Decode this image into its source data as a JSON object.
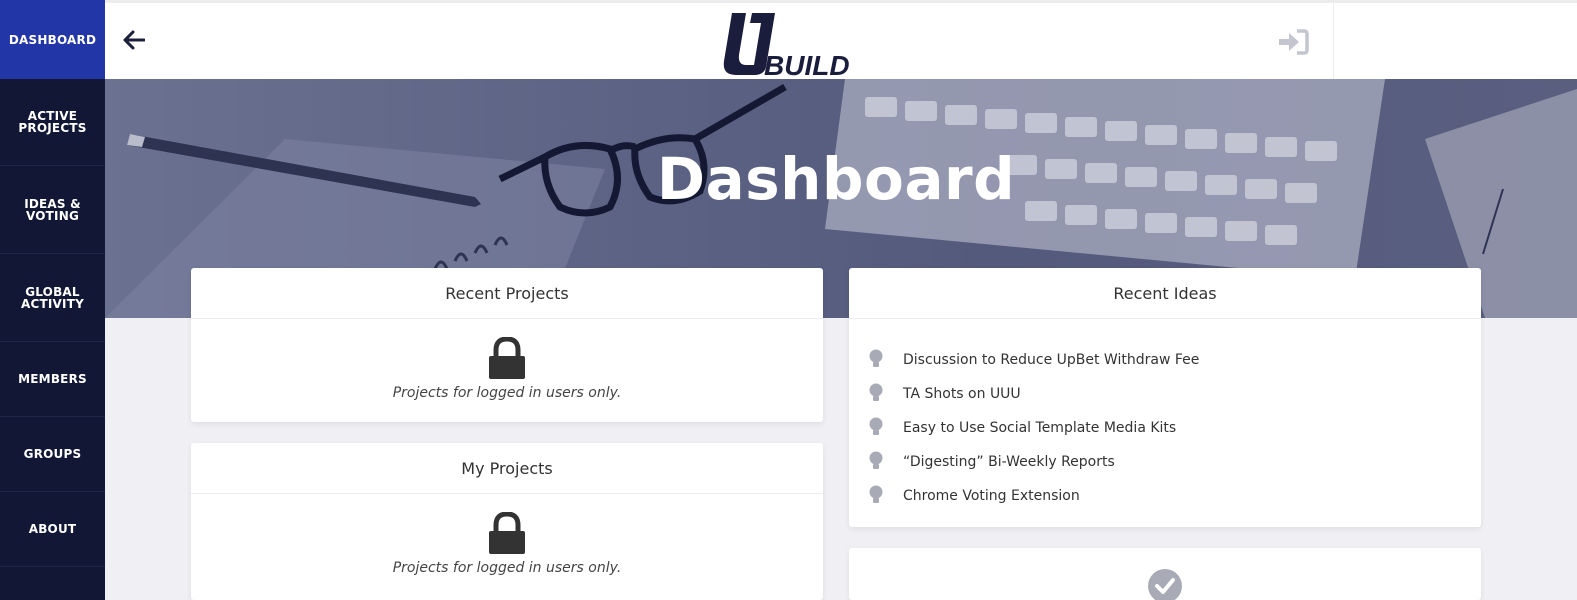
{
  "sidebar": {
    "items": [
      {
        "lines": [
          "DASHBOARD"
        ],
        "active": true
      },
      {
        "lines": [
          "ACTIVE",
          "PROJECTS"
        ],
        "active": false
      },
      {
        "lines": [
          "IDEAS &",
          "VOTING"
        ],
        "active": false
      },
      {
        "lines": [
          "GLOBAL",
          "ACTIVITY"
        ],
        "active": false
      },
      {
        "lines": [
          "MEMBERS"
        ],
        "active": false
      },
      {
        "lines": [
          "GROUPS"
        ],
        "active": false
      },
      {
        "lines": [
          "ABOUT"
        ],
        "active": false
      }
    ]
  },
  "header": {
    "logo_text": "BUILD",
    "logo_letter": "U"
  },
  "hero": {
    "title": "Dashboard"
  },
  "recent_projects": {
    "title": "Recent Projects",
    "message": "Projects for logged in users only."
  },
  "my_projects": {
    "title": "My Projects",
    "message": "Projects for logged in users only."
  },
  "recent_ideas": {
    "title": "Recent Ideas",
    "items": [
      "Discussion to Reduce UpBet Withdraw Fee",
      "TA Shots on UUU",
      "Easy to Use Social Template Media Kits",
      "“Digesting” Bi-Weekly Reports",
      "Chrome Voting Extension"
    ]
  },
  "icons": {
    "back": "arrow-left-icon",
    "login": "sign-in-icon",
    "lock": "lock-icon",
    "idea": "lightbulb-icon",
    "check": "check-circle-icon"
  },
  "colors": {
    "sidebar_bg": "#111735",
    "sidebar_active": "#2336a8",
    "logo_color": "#1a1e3c",
    "hero_overlay": "#545a7c",
    "content_bg": "#f0f0f4"
  }
}
